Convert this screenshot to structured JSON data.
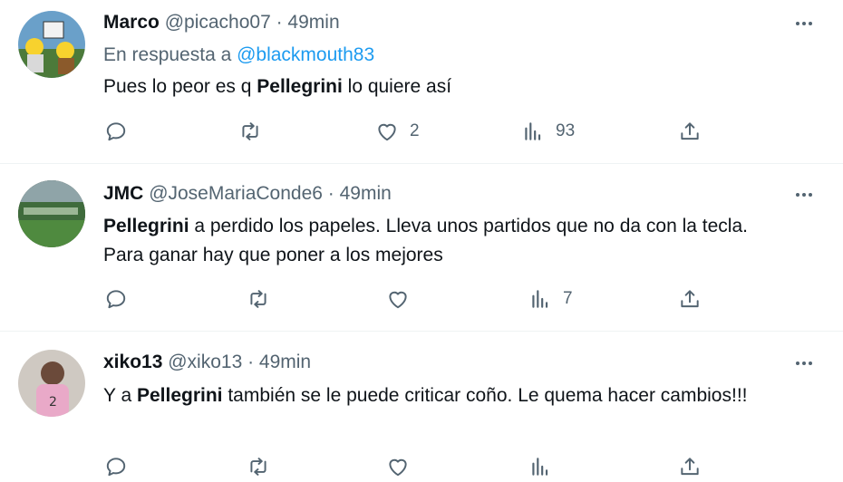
{
  "tweets": [
    {
      "name": "Marco",
      "handle": "@picacho07 · 49min",
      "reply_prefix": "En respuesta a ",
      "reply_mention": "@blackmouth83",
      "text_before": "Pues lo peor es q ",
      "text_bold": "Pellegrini",
      "text_after": " lo quiere así",
      "likes": "2",
      "views": "93"
    },
    {
      "name": "JMC",
      "handle": "@JoseMariaConde6 · 49min",
      "text_before": "",
      "text_bold": "Pellegrini",
      "text_after": " a perdido los papeles. Lleva unos partidos que no da con la tecla.  Para ganar hay que poner a los mejores",
      "likes": "",
      "views": "7"
    },
    {
      "name": "xiko13",
      "handle": "@xiko13 · 49min",
      "text_before": "Y a ",
      "text_bold": "Pellegrini",
      "text_after": " también se le puede criticar coño. Le quema hacer cambios!!!"
    }
  ],
  "icons": [
    "reply-icon",
    "retweet-icon",
    "like-icon",
    "views-icon",
    "share-icon",
    "more-icon"
  ],
  "colors": {
    "text": "#0f1419",
    "secondary": "#536471",
    "link": "#1d9bf0",
    "divider": "#eff3f4"
  }
}
